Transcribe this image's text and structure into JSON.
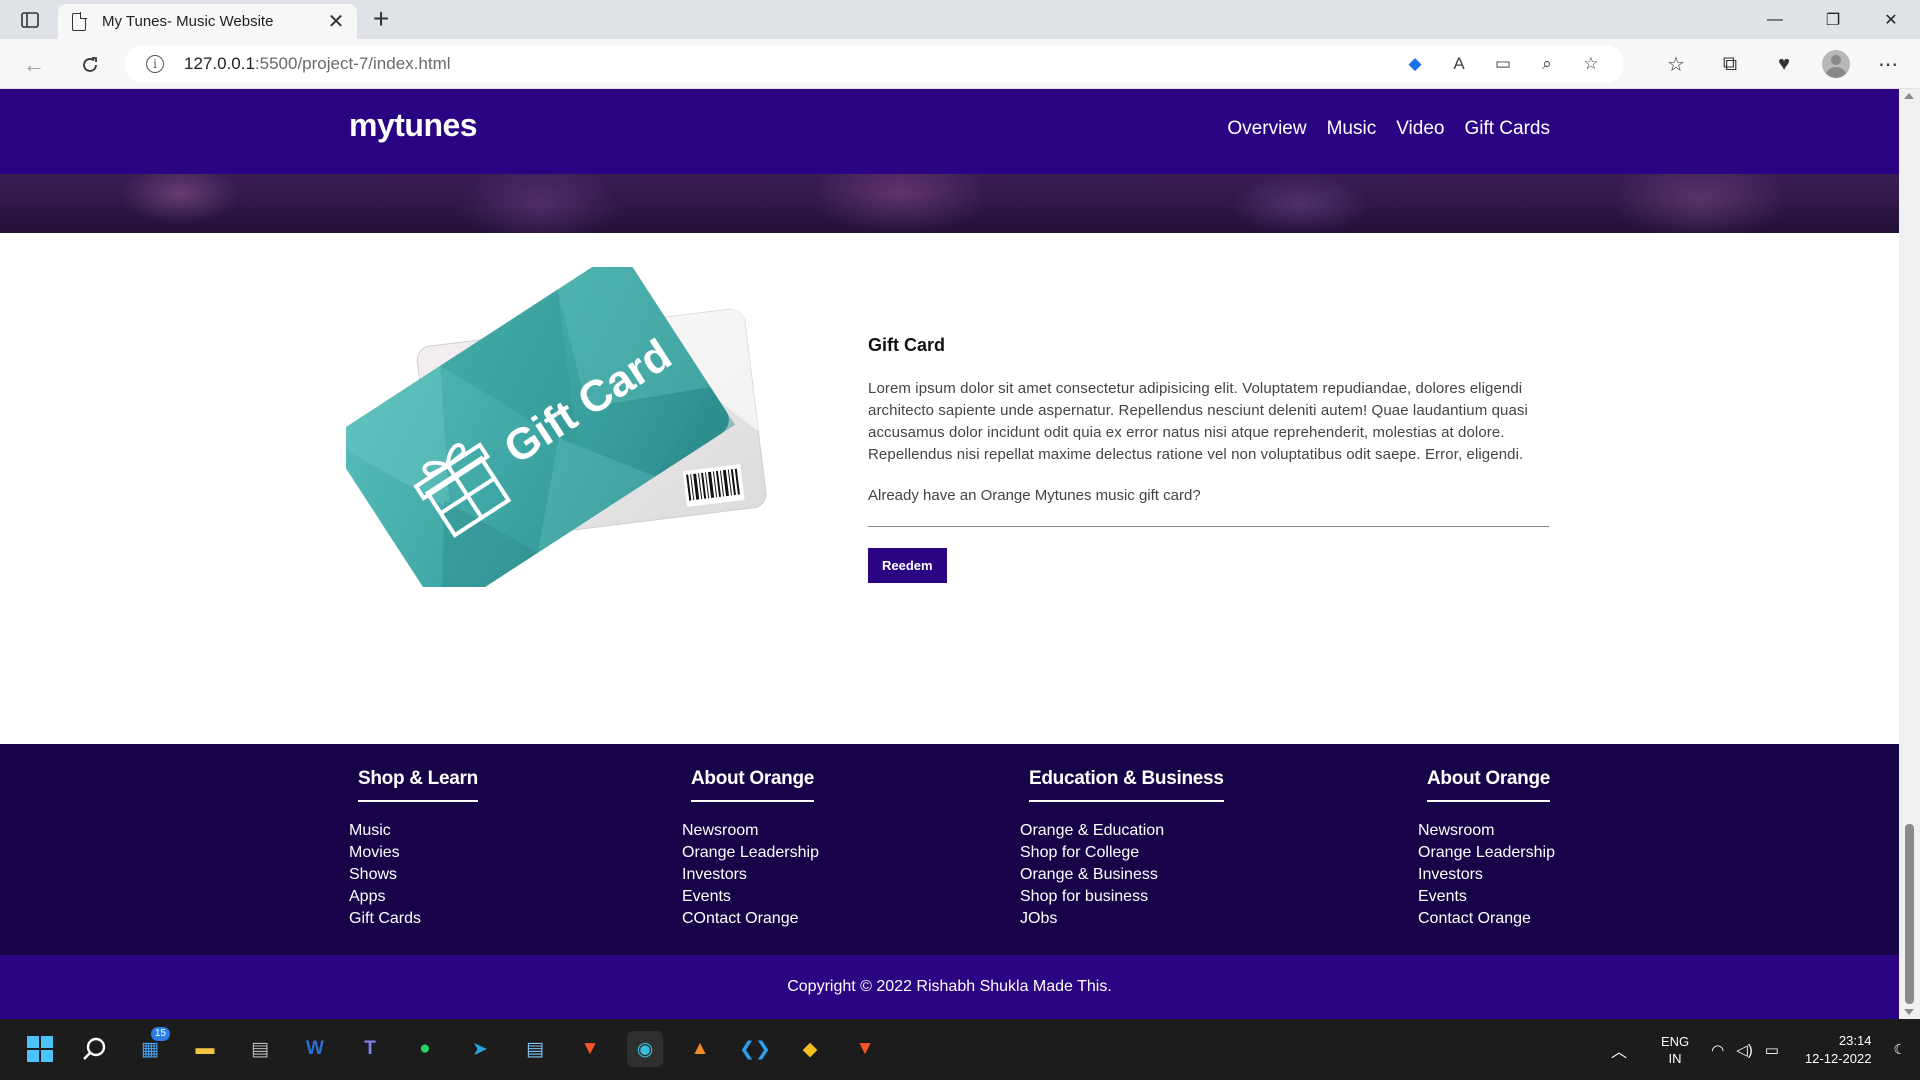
{
  "browser": {
    "tab_title": "My Tunes- Music Website",
    "url_host": "127.0.0.1",
    "url_path": ":5500/project-7/index.html"
  },
  "site": {
    "logo": "mytunes",
    "nav": [
      "Overview",
      "Music",
      "Video",
      "Gift Cards"
    ]
  },
  "giftcard": {
    "art_text": "Gift Card",
    "title": "Gift Card",
    "description": "Lorem ipsum dolor sit amet consectetur adipisicing elit. Voluptatem repudiandae, dolores eligendi architecto sapiente unde aspernatur. Repellendus nesciunt deleniti autem! Quae laudantium quasi accusamus dolor incidunt odit quia ex error natus nisi atque reprehenderit, molestias at dolore. Repellendus nisi repellat maxime delectus ratione vel non voluptatibus odit saepe. Error, eligendi.",
    "question": "Already have an Orange Mytunes music gift card?",
    "button": "Reedem"
  },
  "footer": {
    "columns": [
      {
        "heading": "Shop & Learn",
        "links": [
          "Music",
          "Movies",
          "Shows",
          "Apps",
          "Gift Cards"
        ]
      },
      {
        "heading": "About Orange",
        "links": [
          "Newsroom",
          "Orange Leadership",
          "Investors",
          "Events",
          "COntact Orange"
        ]
      },
      {
        "heading": "Education & Business",
        "links": [
          "Orange & Education",
          "Shop for College",
          "Orange & Business",
          "Shop for business",
          "JObs"
        ]
      },
      {
        "heading": "About Orange",
        "links": [
          "Newsroom",
          "Orange Leadership",
          "Investors",
          "Events",
          "Contact Orange"
        ]
      }
    ],
    "copyright": "Copyright © 2022 Rishabh Shukla Made This."
  },
  "taskbar": {
    "badge": "15",
    "lang_top": "ENG",
    "lang_bottom": "IN",
    "time": "23:14",
    "date": "12-12-2022"
  },
  "colors": {
    "nav_bg": "#2a0483",
    "footer_bg": "#170448",
    "card_teal": "#3ea6a4"
  }
}
